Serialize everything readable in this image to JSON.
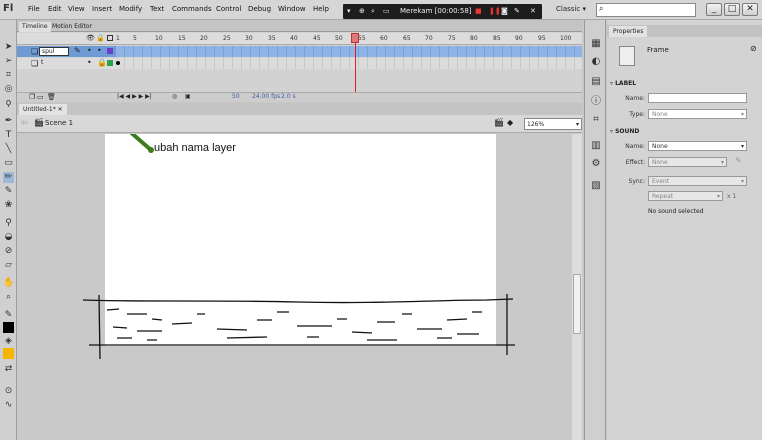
{
  "app": {
    "logo": "Fl"
  },
  "menu": [
    "File",
    "Edit",
    "View",
    "Insert",
    "Modify",
    "Text",
    "Commands",
    "Control",
    "Debug",
    "Window",
    "Help"
  ],
  "recorder": {
    "label": "Merekam [00:00:58]"
  },
  "workspace": "Classic",
  "search": {
    "placeholder": ""
  },
  "window_buttons": [
    "_",
    "□",
    "✕"
  ],
  "timeline": {
    "tabs": [
      "Timeline",
      "Motion Editor"
    ],
    "ruler": [
      "1",
      "5",
      "10",
      "15",
      "20",
      "25",
      "30",
      "35",
      "40",
      "45",
      "50",
      "55",
      "60",
      "65",
      "70",
      "75",
      "80",
      "85",
      "90",
      "95",
      "100"
    ],
    "layers": [
      {
        "name": "spul",
        "selected": true
      },
      {
        "name": "  t",
        "selected": false
      }
    ],
    "status": {
      "frame": "50",
      "fps": "24.00 fps",
      "time": "2.0 s"
    }
  },
  "document": {
    "tab": "Untitled-1*",
    "scene": "Scene 1",
    "zoom": "126%"
  },
  "annotation": "ubah nama layer",
  "properties": {
    "tab": "Properties",
    "type": "Frame",
    "label_section": "LABEL",
    "name_label": "Name:",
    "type_label": "Type:",
    "type_value": "None",
    "sound_section": "SOUND",
    "sound_name_value": "None",
    "effect_label": "Effect:",
    "effect_value": "None",
    "sync_label": "Sync:",
    "sync_value": "Event",
    "repeat_value": "Repeat",
    "repeat_count": "x 1",
    "no_sound": "No sound selected"
  },
  "colors": {
    "selection": "#6e9bd6",
    "playhead": "#e02020",
    "arrow": "#3c7d1e"
  }
}
